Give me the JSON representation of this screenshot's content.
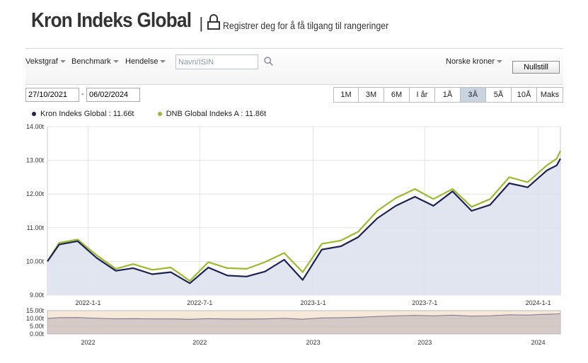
{
  "header": {
    "title": "Kron Indeks Global",
    "separator": "|",
    "register_text": "Registrer deg for å få tilgang til rangeringer"
  },
  "toolbar": {
    "menus": [
      {
        "label": "Vekstgraf",
        "icon": "chevron-down-icon"
      },
      {
        "label": "Benchmark",
        "icon": "chevron-down-icon"
      },
      {
        "label": "Hendelse",
        "icon": "chevron-down-icon"
      }
    ],
    "search_placeholder": "Navn/ISIN",
    "search_icon": "search-icon",
    "currency_label": "Norske kroner",
    "reset_label": "Nullstill"
  },
  "dates": {
    "from": "27/10/2021",
    "separator": "-",
    "to": "06/02/2024"
  },
  "ranges": {
    "options": [
      "1M",
      "3M",
      "6M",
      "I år",
      "1Å",
      "3Å",
      "5Å",
      "10Å",
      "Maks"
    ],
    "selected": "3Å"
  },
  "colors": {
    "fund": "#1c2354",
    "benchmark": "#9abb2b",
    "area_fill": "#dde2ee",
    "navigator_fill": "#c9bfbf",
    "navigator_bg": "#f7e9d9"
  },
  "chart_data": {
    "type": "line",
    "series": [
      {
        "name": "Kron Indeks Global : 11.66t",
        "x": [
          "2021-10-27",
          "2021-11-15",
          "2021-12-15",
          "2022-01-15",
          "2022-02-15",
          "2022-03-15",
          "2022-04-15",
          "2022-05-15",
          "2022-06-15",
          "2022-07-15",
          "2022-08-15",
          "2022-09-15",
          "2022-10-15",
          "2022-11-15",
          "2022-12-15",
          "2023-01-15",
          "2023-02-15",
          "2023-03-15",
          "2023-04-15",
          "2023-05-15",
          "2023-06-15",
          "2023-07-15",
          "2023-08-15",
          "2023-09-15",
          "2023-10-15",
          "2023-11-15",
          "2023-12-15",
          "2024-01-15",
          "2024-01-31",
          "2024-02-06"
        ],
        "values": [
          10.0,
          10.5,
          10.6,
          10.1,
          9.72,
          9.8,
          9.62,
          9.68,
          9.35,
          9.82,
          9.58,
          9.55,
          9.7,
          10.05,
          9.45,
          10.35,
          10.45,
          10.72,
          11.28,
          11.65,
          11.92,
          11.65,
          12.08,
          11.5,
          11.68,
          12.32,
          12.2,
          12.7,
          12.85,
          13.05
        ]
      },
      {
        "name": "DNB Global Indeks A : 11.86t",
        "x": [
          "2021-10-27",
          "2021-11-15",
          "2021-12-15",
          "2022-01-15",
          "2022-02-15",
          "2022-03-15",
          "2022-04-15",
          "2022-05-15",
          "2022-06-15",
          "2022-07-15",
          "2022-08-15",
          "2022-09-15",
          "2022-10-15",
          "2022-11-15",
          "2022-12-15",
          "2023-01-15",
          "2023-02-15",
          "2023-03-15",
          "2023-04-15",
          "2023-05-15",
          "2023-06-15",
          "2023-07-15",
          "2023-08-15",
          "2023-09-15",
          "2023-10-15",
          "2023-11-15",
          "2023-12-15",
          "2024-01-15",
          "2024-01-31",
          "2024-02-06"
        ],
        "values": [
          10.0,
          10.55,
          10.65,
          10.18,
          9.78,
          9.92,
          9.75,
          9.82,
          9.42,
          9.98,
          9.8,
          9.78,
          9.98,
          10.25,
          9.68,
          10.52,
          10.62,
          10.88,
          11.5,
          11.88,
          12.15,
          11.85,
          12.15,
          11.62,
          11.85,
          12.5,
          12.35,
          12.85,
          13.05,
          13.28
        ]
      }
    ],
    "xlabel": "",
    "ylabel": "",
    "ylim": [
      9.0,
      14.0
    ],
    "yticks": [
      {
        "value": 9,
        "label": "9.00t"
      },
      {
        "value": 10,
        "label": "10.00t"
      },
      {
        "value": 11,
        "label": "11.00t"
      },
      {
        "value": 12,
        "label": "12.00t"
      },
      {
        "value": 13,
        "label": "13.00t"
      },
      {
        "value": 14,
        "label": "14.00t"
      }
    ],
    "xlim": [
      "2021-10-27",
      "2024-02-06"
    ],
    "xticks": [
      {
        "value": "2022-01-01",
        "label": "2022-1-1"
      },
      {
        "value": "2022-07-01",
        "label": "2022-7-1"
      },
      {
        "value": "2023-01-01",
        "label": "2023-1-1"
      },
      {
        "value": "2023-07-01",
        "label": "2023-7-1"
      },
      {
        "value": "2024-01-01",
        "label": "2024-1-1"
      }
    ],
    "grid": true,
    "legend_position": "top-left",
    "navigator": {
      "ylim": [
        0,
        15
      ],
      "yticks": [
        {
          "value": 15,
          "label": "15.00t"
        },
        {
          "value": 10,
          "label": "10.00t"
        },
        {
          "value": 5,
          "label": "5.00t"
        },
        {
          "value": 0,
          "label": "0.00t"
        }
      ],
      "xticks": [
        {
          "value": "2022-01-01",
          "label": "2022"
        },
        {
          "value": "2022-07-01",
          "label": "2022"
        },
        {
          "value": "2023-01-01",
          "label": "2023"
        },
        {
          "value": "2023-07-01",
          "label": "2023"
        },
        {
          "value": "2024-01-01",
          "label": "2024"
        }
      ]
    }
  }
}
